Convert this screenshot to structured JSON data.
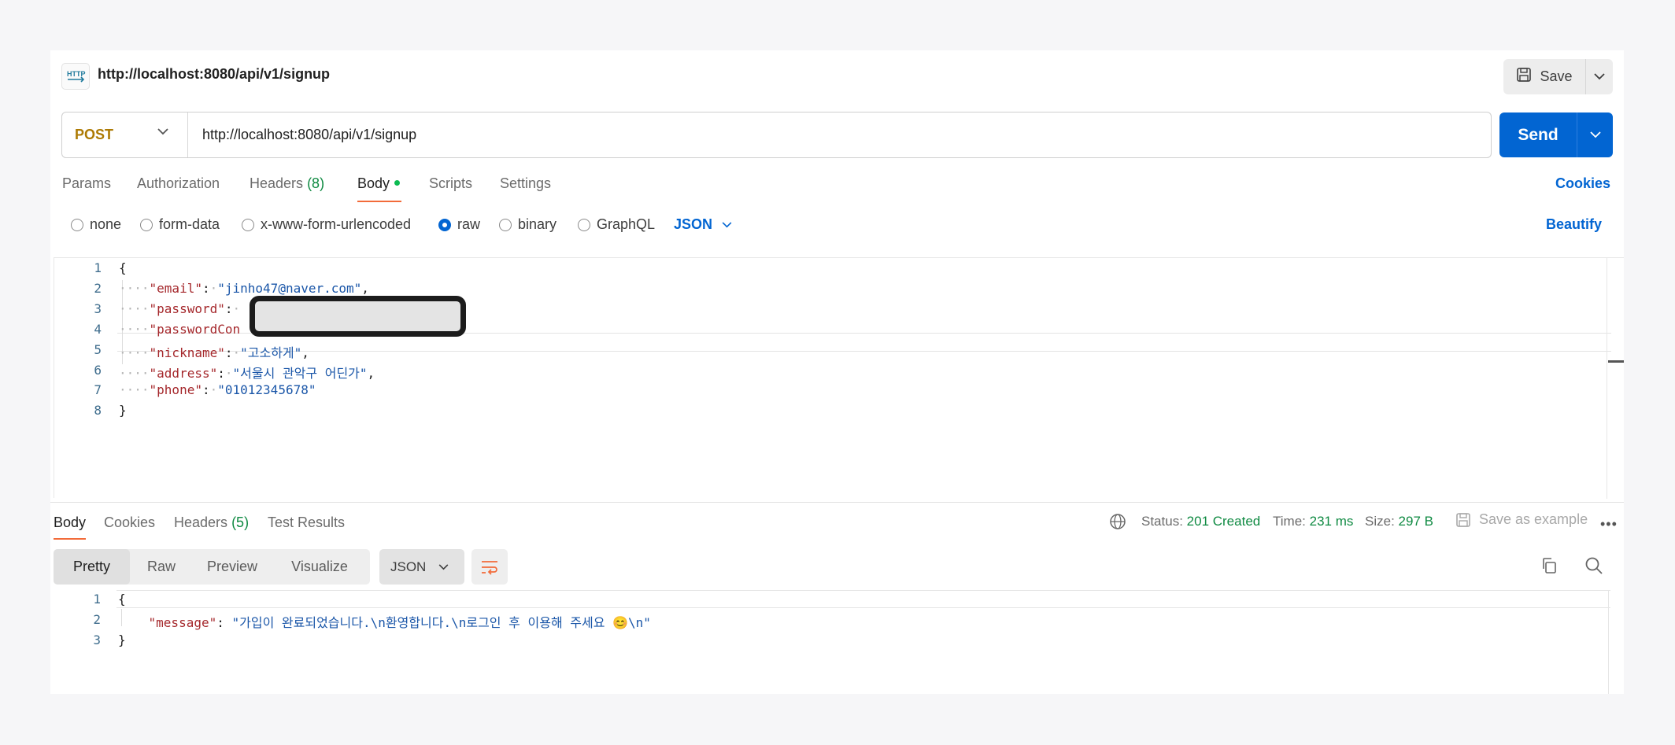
{
  "request": {
    "title": "http://localhost:8080/api/v1/signup",
    "save_label": "Save",
    "method": "POST",
    "url": "http://localhost:8080/api/v1/signup",
    "send_label": "Send"
  },
  "tabs": {
    "params": "Params",
    "authorization": "Authorization",
    "headers": "Headers",
    "headers_count": "(8)",
    "body": "Body",
    "scripts": "Scripts",
    "settings": "Settings",
    "cookies": "Cookies",
    "active": "Body"
  },
  "body_options": {
    "none": "none",
    "form_data": "form-data",
    "urlencoded": "x-www-form-urlencoded",
    "raw": "raw",
    "binary": "binary",
    "graphql": "GraphQL",
    "selected": "raw",
    "format": "JSON",
    "beautify": "Beautify"
  },
  "editor": {
    "line_numbers": [
      "1",
      "2",
      "3",
      "4",
      "5",
      "6",
      "7",
      "8"
    ],
    "open_brace": "{",
    "close_brace": "}",
    "email_key": "\"email\"",
    "email_val": "\"jinho47@naver.com\"",
    "password_key": "\"password\"",
    "password_confirm_key": "\"passwordCon",
    "nickname_key": "\"nickname\"",
    "nickname_val": "\"고소하게\"",
    "address_key": "\"address\"",
    "address_val": "\"서울시 관악구 어딘가\"",
    "phone_key": "\"phone\"",
    "phone_val": "\"01012345678\""
  },
  "response": {
    "tabs": {
      "body": "Body",
      "cookies": "Cookies",
      "headers": "Headers",
      "headers_count": "(5)",
      "test_results": "Test Results"
    },
    "status_label": "Status:",
    "status_value": "201 Created",
    "time_label": "Time:",
    "time_value": "231 ms",
    "size_label": "Size:",
    "size_value": "297 B",
    "save_example": "Save as example",
    "more": "•••",
    "views": [
      "Pretty",
      "Raw",
      "Preview",
      "Visualize"
    ],
    "active_view": "Pretty",
    "format": "JSON",
    "line_numbers": [
      "1",
      "2",
      "3"
    ],
    "open_brace": "{",
    "close_brace": "}",
    "message_key": "\"message\"",
    "message_val": "\"가입이 완료되었습니다.\\n환영합니다.\\n로그인 후 이용해 주세요 😊\\n\""
  },
  "colors": {
    "send": "#0265d2",
    "method": "#ad7a03",
    "status_ok": "#0f8a42",
    "active_tab": "#f26b3a",
    "json_key": "#a5282c",
    "json_string": "#1a56a8"
  },
  "icons": [
    "http-icon",
    "save-icon",
    "chevron-down-icon",
    "globe-icon",
    "wrap-icon",
    "copy-icon",
    "search-icon"
  ]
}
